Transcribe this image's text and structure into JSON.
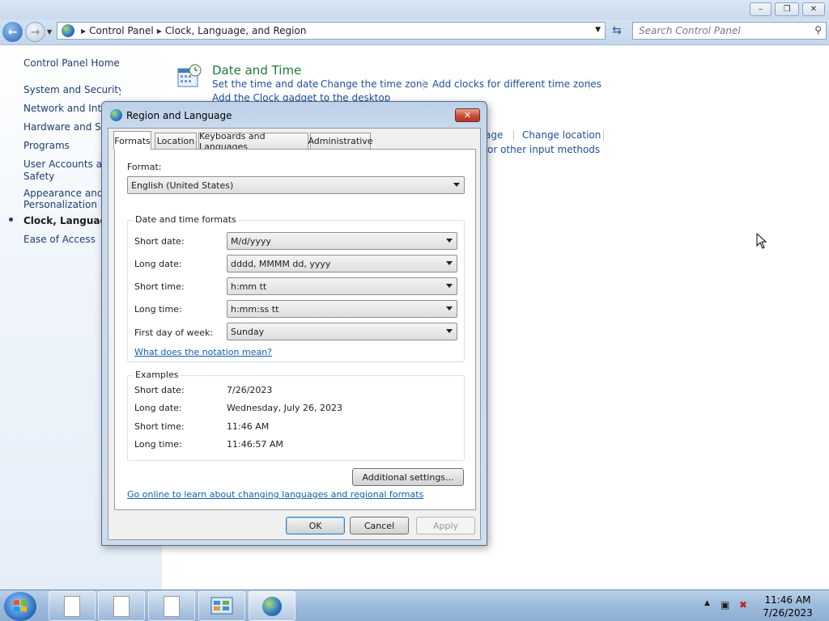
{
  "window": {
    "minimize": "–",
    "maximize": "❐",
    "close": "✕"
  },
  "address": {
    "crumbs": [
      "Control Panel",
      "Clock, Language, and Region"
    ],
    "search_placeholder": "Search Control Panel"
  },
  "sidebar": {
    "home": "Control Panel Home",
    "items": [
      {
        "label": "System and Security"
      },
      {
        "label": "Network and Internet"
      },
      {
        "label": "Hardware and Sound"
      },
      {
        "label": "Programs"
      },
      {
        "label": "User Accounts and Family Safety",
        "line1": "User Accounts and",
        "line2": "Safety"
      },
      {
        "label": "Appearance and Personalization",
        "line1": "Appearance and",
        "line2": "Personalization"
      },
      {
        "label": "Clock, Language, and Region",
        "active": true
      },
      {
        "label": "Ease of Access"
      }
    ]
  },
  "main": {
    "date_time": {
      "title": "Date and Time",
      "links": [
        "Set the time and date",
        "Change the time zone",
        "Add clocks for different time zones",
        "Add the Clock gadget to the desktop"
      ]
    },
    "region_partial": {
      "links": [
        "age",
        "Change location",
        "or other input methods"
      ]
    }
  },
  "dialog": {
    "title": "Region and Language",
    "close": "✕",
    "tabs": [
      "Formats",
      "Location",
      "Keyboards and Languages",
      "Administrative"
    ],
    "active_tab": "Formats",
    "format_label": "Format:",
    "format_value": "English (United States)",
    "dtf_group": "Date and time formats",
    "rows": [
      {
        "label": "Short date:",
        "value": "M/d/yyyy"
      },
      {
        "label": "Long date:",
        "value": "dddd, MMMM dd, yyyy"
      },
      {
        "label": "Short time:",
        "value": "h:mm tt"
      },
      {
        "label": "Long time:",
        "value": "h:mm:ss tt"
      },
      {
        "label": "First day of week:",
        "value": "Sunday"
      }
    ],
    "notation_link": "What does the notation mean?",
    "examples_group": "Examples",
    "examples": [
      {
        "label": "Short date:",
        "value": "7/26/2023"
      },
      {
        "label": "Long date:",
        "value": "Wednesday, July 26, 2023"
      },
      {
        "label": "Short time:",
        "value": "11:46 AM"
      },
      {
        "label": "Long time:",
        "value": "11:46:57 AM"
      }
    ],
    "additional_settings": "Additional settings...",
    "online_link": "Go online to learn about changing languages and regional formats",
    "ok": "OK",
    "cancel": "Cancel",
    "apply": "Apply"
  },
  "taskbar": {
    "time": "11:46 AM",
    "date": "7/26/2023"
  },
  "colors": {
    "link": "#1e4f9a",
    "category_title": "#1e7a3a",
    "close_button": "#c74b36"
  }
}
